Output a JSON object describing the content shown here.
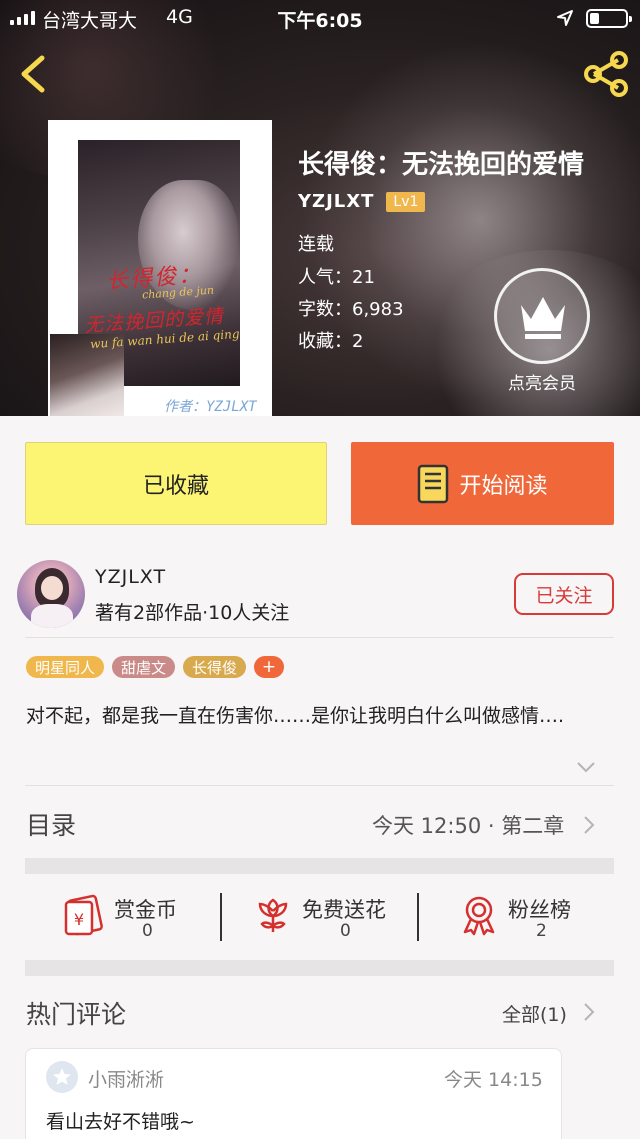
{
  "status_bar": {
    "carrier": "台湾大哥大",
    "network": "4G",
    "time": "下午6:05",
    "battery_level": 0.25
  },
  "colors": {
    "accent_orange": "#f0673a",
    "collect_yellow": "#fcf473",
    "follow_red": "#d83a3a",
    "level_badge": "#efb74c",
    "icon_yellow": "#f5d84e",
    "stat_icon_red": "#d4302e"
  },
  "book": {
    "title": "长得俊：无法挽回的爱情",
    "author": "YZJLXT",
    "level": "Lv1",
    "status": "连载",
    "popularity": "人气：21",
    "word_count": "字数：6,983",
    "favorites": "收藏：2",
    "cover": {
      "title_line1": "长得俊：",
      "pinyin_line1": "chang de jun",
      "title_line2": "无法挽回的爱情",
      "pinyin_line2": "wu fa wan hui de ai qing",
      "author_line": "作者：YZJLXT"
    }
  },
  "vip": {
    "label": "点亮会员",
    "icon": "crown-icon"
  },
  "actions": {
    "collected_label": "已收藏",
    "read_label": "开始阅读",
    "read_icon": "book-icon"
  },
  "author_card": {
    "name": "YZJLXT",
    "stats": "著有2部作品·10人关注",
    "follow_label": "已关注"
  },
  "tags": [
    {
      "label": "明星同人",
      "color": "#efb74c"
    },
    {
      "label": "甜虐文",
      "color": "#c98a88"
    },
    {
      "label": "长得俊",
      "color": "#d9a94e"
    }
  ],
  "tag_add_label": "+",
  "synopsis": "对不起，都是我一直在伤害你……是你让我明白什么叫做感情….",
  "toc": {
    "title": "目录",
    "latest": "今天 12:50 · 第二章"
  },
  "stats": [
    {
      "label": "赏金币",
      "value": "0",
      "icon": "red-envelope-icon"
    },
    {
      "label": "免费送花",
      "value": "0",
      "icon": "flower-icon"
    },
    {
      "label": "粉丝榜",
      "value": "2",
      "icon": "medal-icon"
    }
  ],
  "comments": {
    "title": "热门评论",
    "all_label": "全部(1)",
    "items": [
      {
        "user": "小雨淅淅",
        "time": "今天 14:15",
        "text": "看山去好不错哦~"
      }
    ]
  }
}
